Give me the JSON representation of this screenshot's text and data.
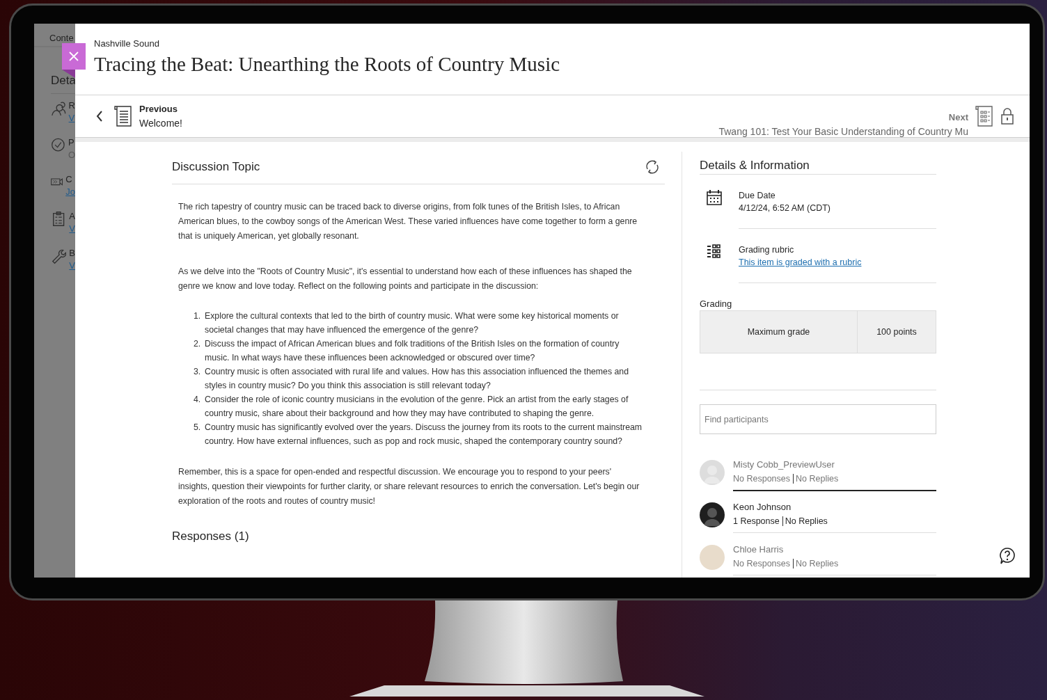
{
  "backdrop": {
    "tab": "Conte",
    "heading": "Deta",
    "items": [
      {
        "kind": "people",
        "letter": "R",
        "sub": "V",
        "link": true
      },
      {
        "kind": "check",
        "letter": "P",
        "sub": "O",
        "link": false
      },
      {
        "kind": "video",
        "letter": "C",
        "sub": "Jo",
        "link": true
      },
      {
        "kind": "clipboard",
        "letter": "A",
        "sub": "V",
        "link": true
      },
      {
        "kind": "wrench",
        "letter": "B",
        "sub": "V",
        "link": true
      }
    ]
  },
  "header": {
    "course": "Nashville Sound",
    "title": "Tracing the Beat: Unearthing the Roots of Country Music"
  },
  "nav": {
    "previous": {
      "label": "Previous",
      "title": "Welcome!"
    },
    "next": {
      "label": "Next",
      "title": "Twang 101: Test Your Basic Understanding of Country Mu",
      "locked": true
    }
  },
  "discussion": {
    "heading": "Discussion Topic",
    "blocks": [
      {
        "kind": "paragraph",
        "text": "The rich tapestry of country music can be traced back to diverse origins, from folk tunes of the British Isles, to African American blues, to the cowboy songs of the American West. These varied influences have come together to form a genre that is uniquely American, yet globally resonant."
      },
      {
        "kind": "paragraph",
        "text": "As we delve into the \"Roots of Country Music\", it's essential to understand how each of these influences has shaped the genre we know and love today. Reflect on the following points and participate in the discussion:"
      },
      {
        "kind": "list",
        "items": [
          {
            "number": "1.",
            "text": "Explore the cultural contexts that led to the birth of country music. What were some key historical moments or societal changes that may have influenced the emergence of the genre?"
          },
          {
            "number": "2.",
            "text": "Discuss the impact of African American blues and folk traditions of the British Isles on the formation of country music. In what ways have these influences been acknowledged or obscured over time?"
          },
          {
            "number": "3.",
            "text": "Country music is often associated with rural life and values. How has this association influenced the themes and styles in country music? Do you think this association is still relevant today?"
          },
          {
            "number": "4.",
            "text": "Consider the role of iconic country musicians in the evolution of the genre. Pick an artist from the early stages of country music, share about their background and how they may have contributed to shaping the genre."
          },
          {
            "number": "5.",
            "text": "Country music has significantly evolved over the years. Discuss the journey from its roots to the current mainstream country. How have external influences, such as pop and rock music, shaped the contemporary country sound?"
          }
        ]
      },
      {
        "kind": "paragraph",
        "text": "Remember, this is a space for open-ended and respectful discussion. We encourage you to respond to your peers' insights, question their viewpoints for further clarity, or share relevant resources to enrich the conversation. Let's begin our exploration of the roots and routes of country music!"
      }
    ],
    "responses_heading": "Responses (1)"
  },
  "details": {
    "heading": "Details & Information",
    "items": [
      {
        "kind": "due",
        "label": "Due Date",
        "value": "4/12/24, 6:52 AM (CDT)"
      },
      {
        "kind": "rubric",
        "label": "Grading rubric",
        "link": "This item is graded with a rubric"
      }
    ],
    "grading": {
      "label": "Grading",
      "name": "Maximum grade",
      "value": "100 points"
    },
    "search": {
      "placeholder": "Find participants"
    },
    "participants": [
      {
        "name": "Misty Cobb_PreviewUser",
        "responses": "No Responses",
        "replies": "No Replies",
        "kind": "default-light",
        "active": false,
        "focused": true
      },
      {
        "name": "Keon Johnson",
        "responses": "1 Response",
        "replies": "No Replies",
        "kind": "default-dark",
        "active": true,
        "focused": false
      },
      {
        "name": "Chloe Harris",
        "responses": "No Responses",
        "replies": "No Replies",
        "kind": "photo",
        "active": false,
        "focused": false
      }
    ]
  }
}
